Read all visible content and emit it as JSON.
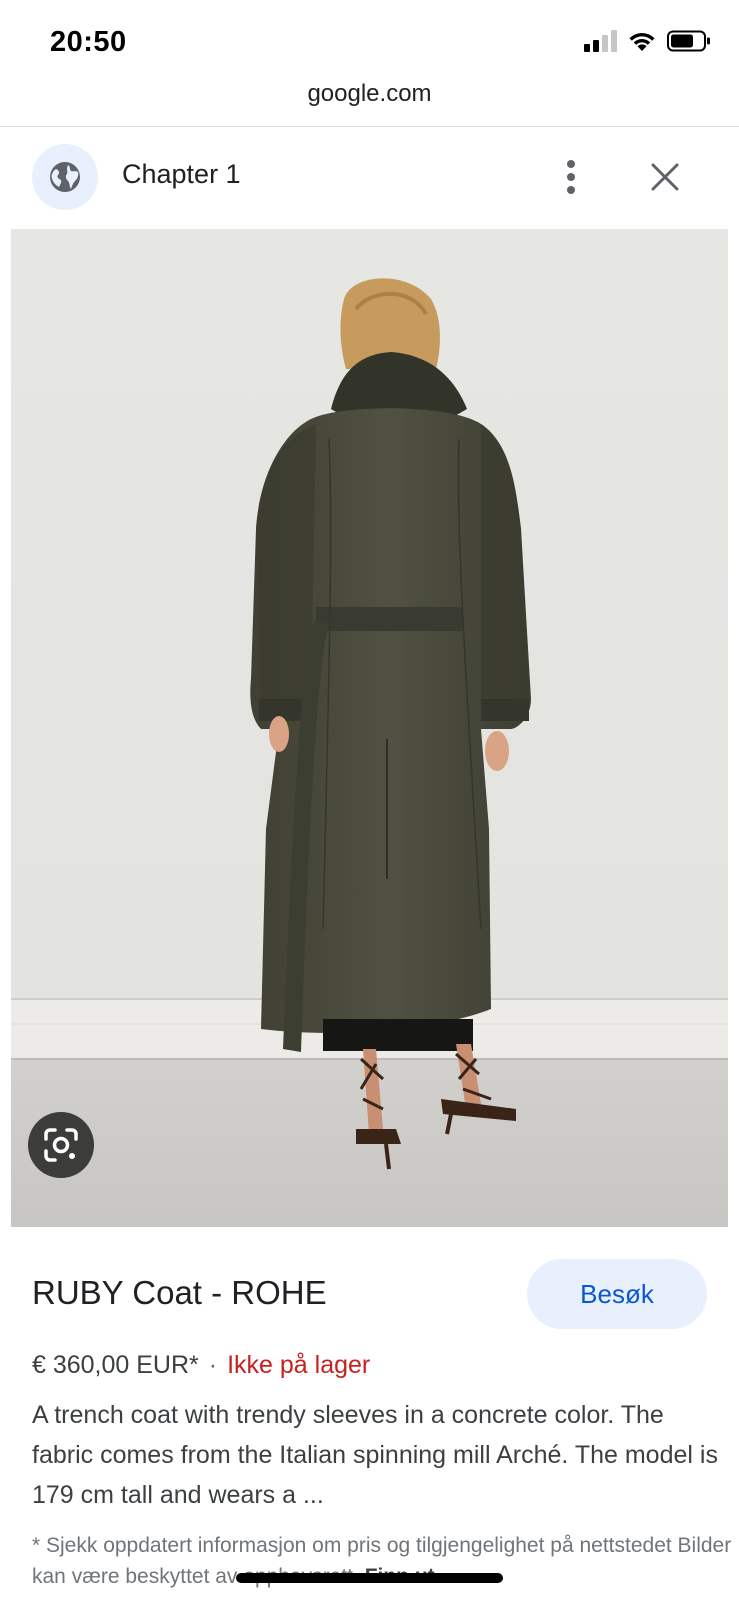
{
  "status_bar": {
    "time": "20:50"
  },
  "browser": {
    "url": "google.com"
  },
  "header": {
    "site_title": "Chapter 1",
    "globe_icon": "globe-icon",
    "more_icon": "more-vert-icon",
    "close_icon": "close-icon"
  },
  "image": {
    "lens_icon": "google-lens-icon"
  },
  "product": {
    "title": "RUBY Coat - ROHE",
    "visit_label": "Besøk",
    "price": "€ 360,00 EUR*",
    "separator": "·",
    "stock_status": "Ikke på lager",
    "description": "A trench coat with trendy sleeves in a concrete color. The fabric comes from the Italian spinning mill Arché. The model is 179 cm tall and wears a ...",
    "disclaimer": "* Sjekk oppdatert informasjon om pris og tilgjengelighet på nettstedet Bilder kan være beskyttet av opphavsrett.",
    "disclaimer_link": "Finn ut"
  },
  "colors": {
    "accent": "#0b57d0",
    "visit_bg": "#e8f0fe",
    "out_of_stock": "#c5221f",
    "coat": "#4a4b3c"
  }
}
